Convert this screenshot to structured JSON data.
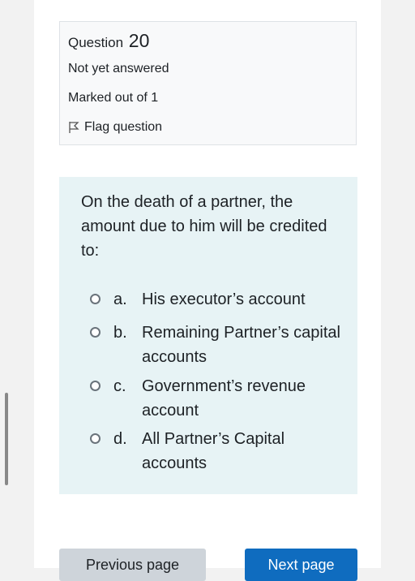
{
  "question_info": {
    "label": "Question",
    "number": "20",
    "state": "Not yet answered",
    "grade": "Marked out of 1",
    "flag_label": "Flag question"
  },
  "question": {
    "text": "On the death of a partner, the amount due to him will be credited to:",
    "options": [
      {
        "letter": "a.",
        "text": "His executor’s account"
      },
      {
        "letter": "b.",
        "text": "Remaining Partner’s capital accounts"
      },
      {
        "letter": "c.",
        "text": "Government’s revenue account"
      },
      {
        "letter": "d.",
        "text": "All Partner’s Capital accounts"
      }
    ]
  },
  "navigation": {
    "previous_label": "Previous page",
    "next_label": "Next page"
  },
  "colors": {
    "background": "#f2f2f2",
    "info_box": "#f8f9fa",
    "formulation_box": "#e7f3f5",
    "primary": "#0f6cbf",
    "secondary": "#ced4da"
  }
}
